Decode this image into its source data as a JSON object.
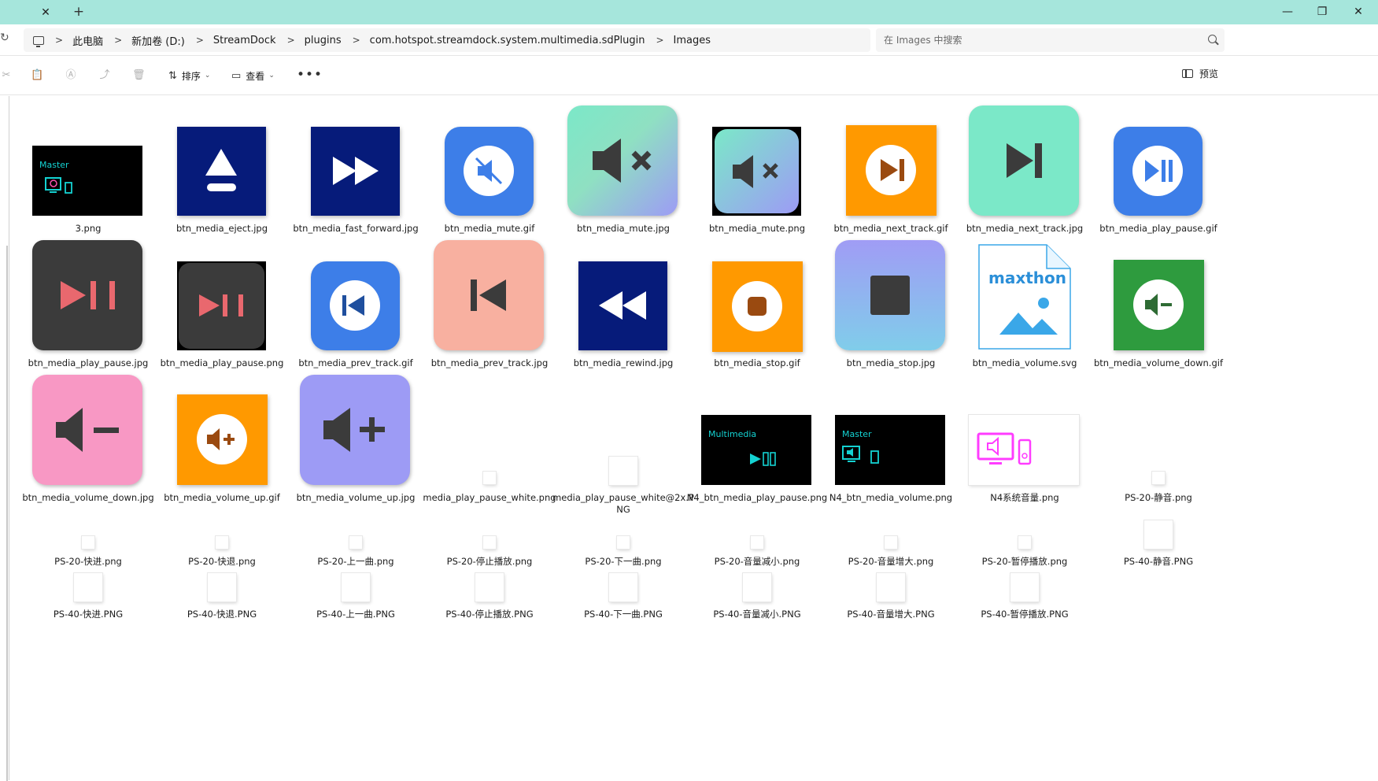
{
  "titlebar": {
    "close_tab": "✕",
    "add_tab": "+",
    "minimize": "—",
    "maximize": "❐",
    "close_window": "✕"
  },
  "breadcrumb": [
    "此电脑",
    "新加卷 (D:)",
    "StreamDock",
    "plugins",
    "com.hotspot.streamdock.system.multimedia.sdPlugin",
    "Images"
  ],
  "search": {
    "placeholder": "在 Images 中搜索"
  },
  "toolbar": {
    "sort_label": "排序",
    "view_label": "查看",
    "more_label": "•••",
    "preview_label": "预览"
  },
  "thumb_text": {
    "master": "Master",
    "multimedia": "Multimedia",
    "maxthon": "maxthon"
  },
  "colors": {
    "titlebar": "#a6e6dc",
    "navy": "#061b7a",
    "blue": "#3d7ee8",
    "orange": "#ff9900",
    "mint": "#7be8c8",
    "salmon": "#f8b0a0",
    "lavender": "#9d9bf5",
    "pink": "#f898c4",
    "green": "#2e9b3e",
    "darkgray": "#3b3b3b",
    "cyan": "#14d2d2",
    "magenta": "#ff3cff"
  },
  "files": [
    {
      "name": "3.png",
      "icon": "master-monitor"
    },
    {
      "name": "btn_media_eject.jpg",
      "icon": "eject-icon"
    },
    {
      "name": "btn_media_fast_forward.jpg",
      "icon": "fast-forward-icon"
    },
    {
      "name": "btn_media_mute.gif",
      "icon": "mute-icon"
    },
    {
      "name": "btn_media_mute.jpg",
      "icon": "mute-icon"
    },
    {
      "name": "btn_media_mute.png",
      "icon": "mute-icon"
    },
    {
      "name": "btn_media_next_track.gif",
      "icon": "next-track-icon"
    },
    {
      "name": "btn_media_next_track.jpg",
      "icon": "next-track-icon"
    },
    {
      "name": "btn_media_play_pause.gif",
      "icon": "play-pause-icon"
    },
    {
      "name": "btn_media_play_pause.jpg",
      "icon": "play-pause-icon"
    },
    {
      "name": "btn_media_play_pause.png",
      "icon": "play-pause-icon"
    },
    {
      "name": "btn_media_prev_track.gif",
      "icon": "prev-track-icon"
    },
    {
      "name": "btn_media_prev_track.jpg",
      "icon": "prev-track-icon"
    },
    {
      "name": "btn_media_rewind.jpg",
      "icon": "rewind-icon"
    },
    {
      "name": "btn_media_stop.gif",
      "icon": "stop-icon"
    },
    {
      "name": "btn_media_stop.jpg",
      "icon": "stop-icon"
    },
    {
      "name": "btn_media_volume.svg",
      "icon": "maxthon-image-icon"
    },
    {
      "name": "btn_media_volume_down.gif",
      "icon": "volume-down-icon"
    },
    {
      "name": "btn_media_volume_down.jpg",
      "icon": "volume-down-icon"
    },
    {
      "name": "btn_media_volume_up.gif",
      "icon": "volume-up-icon"
    },
    {
      "name": "btn_media_volume_up.jpg",
      "icon": "volume-up-icon"
    },
    {
      "name": "media_play_pause_white.png",
      "icon": "blank"
    },
    {
      "name": "media_play_pause_white@2x.PNG",
      "icon": "blank"
    },
    {
      "name": "N4_btn_media_play_pause.png",
      "icon": "multimedia-play-pause"
    },
    {
      "name": "N4_btn_media_volume.png",
      "icon": "master-monitor"
    },
    {
      "name": "N4系统音量.png",
      "icon": "neon-speaker-monitor"
    },
    {
      "name": "PS-20-静音.png",
      "icon": "blank"
    },
    {
      "name": "PS-20-快进.png",
      "icon": "blank"
    },
    {
      "name": "PS-20-快退.png",
      "icon": "blank"
    },
    {
      "name": "PS-20-上一曲.png",
      "icon": "blank"
    },
    {
      "name": "PS-20-停止播放.png",
      "icon": "blank"
    },
    {
      "name": "PS-20-下一曲.png",
      "icon": "blank"
    },
    {
      "name": "PS-20-音量减小.png",
      "icon": "blank"
    },
    {
      "name": "PS-20-音量增大.png",
      "icon": "blank"
    },
    {
      "name": "PS-20-暂停播放.png",
      "icon": "blank"
    },
    {
      "name": "PS-40-静音.PNG",
      "icon": "blank"
    },
    {
      "name": "PS-40-快进.PNG",
      "icon": "blank"
    },
    {
      "name": "PS-40-快退.PNG",
      "icon": "blank"
    },
    {
      "name": "PS-40-上一曲.PNG",
      "icon": "blank"
    },
    {
      "name": "PS-40-停止播放.PNG",
      "icon": "blank"
    },
    {
      "name": "PS-40-下一曲.PNG",
      "icon": "blank"
    },
    {
      "name": "PS-40-音量减小.PNG",
      "icon": "blank"
    },
    {
      "name": "PS-40-音量增大.PNG",
      "icon": "blank"
    },
    {
      "name": "PS-40-暂停播放.PNG",
      "icon": "blank"
    }
  ]
}
